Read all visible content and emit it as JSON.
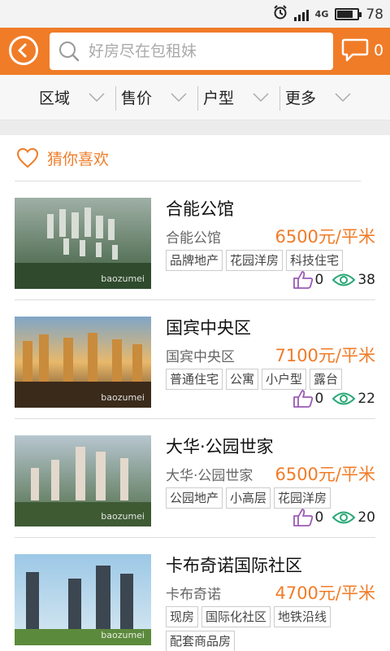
{
  "status_bar": {
    "signal_label": "4G",
    "battery": "78",
    "battery_level": 0.78
  },
  "header": {
    "search_placeholder": "好房尽在包租妹",
    "message_count": "0"
  },
  "filters": [
    "区域",
    "售价",
    "户型",
    "更多"
  ],
  "section": {
    "title": "猜你喜欢"
  },
  "listings": [
    {
      "name": "合能公馆",
      "sub": "合能公馆",
      "price": "6500元/平米",
      "tags": [
        "品牌地产",
        "花园洋房",
        "科技住宅"
      ],
      "likes": "0",
      "views": "38",
      "watermark": "baozumei"
    },
    {
      "name": "国宾中央区",
      "sub": "国宾中央区",
      "price": "7100元/平米",
      "tags": [
        "普通住宅",
        "公寓",
        "小户型",
        "露台"
      ],
      "likes": "0",
      "views": "22",
      "watermark": "baozumei"
    },
    {
      "name": "大华·公园世家",
      "sub": "大华·公园世家",
      "price": "6500元/平米",
      "tags": [
        "公园地产",
        "小高层",
        "花园洋房"
      ],
      "likes": "0",
      "views": "20",
      "watermark": "baozumei"
    },
    {
      "name": "卡布奇诺国际社区",
      "sub": "卡布奇诺",
      "price": "4700元/平米",
      "tags": [
        "现房",
        "国际化社区",
        "地铁沿线",
        "配套商品房"
      ],
      "likes": "",
      "views": "",
      "watermark": "baozumei"
    }
  ]
}
